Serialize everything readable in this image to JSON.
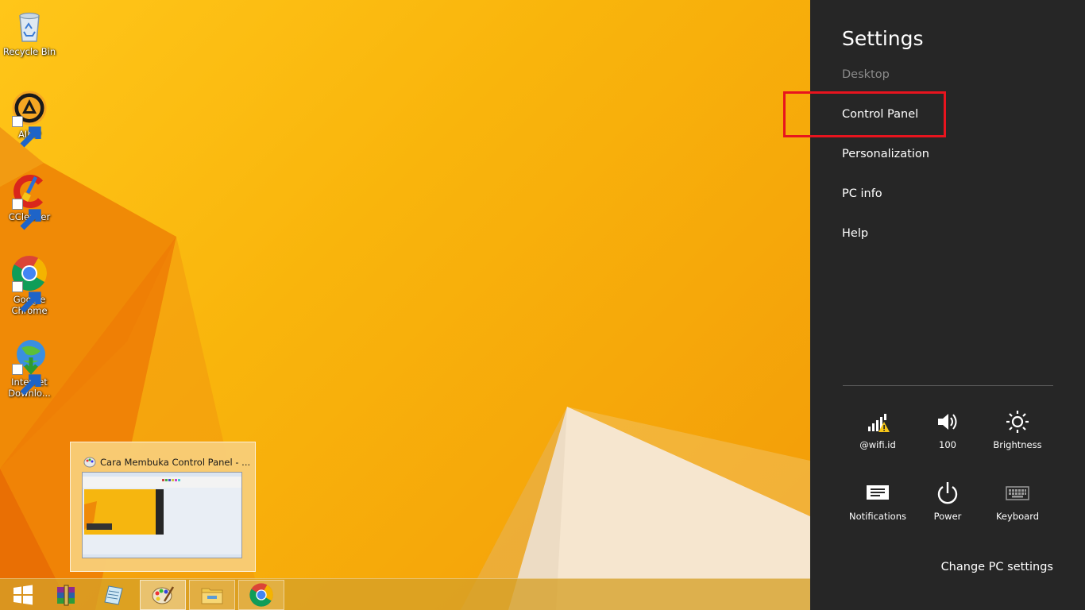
{
  "desktop": {
    "icons": [
      {
        "label": "Recycle Bin",
        "icon": "recycle-bin-icon"
      },
      {
        "label": "AIMP",
        "icon": "aimp-icon"
      },
      {
        "label": "CCleaner",
        "icon": "ccleaner-icon"
      },
      {
        "label": "Google Chrome",
        "icon": "chrome-icon"
      },
      {
        "label": "Internet Downlo...",
        "icon": "idm-icon"
      }
    ]
  },
  "taskbar": {
    "buttons": [
      {
        "name": "start",
        "icon": "windows-start-icon"
      },
      {
        "name": "winrar",
        "icon": "winrar-icon"
      },
      {
        "name": "notepad",
        "icon": "notepad-icon"
      },
      {
        "name": "paint",
        "icon": "paint-icon"
      },
      {
        "name": "file-explorer",
        "icon": "folder-icon"
      },
      {
        "name": "chrome",
        "icon": "chrome-icon"
      }
    ],
    "preview_title": "Cara Membuka Control Panel - ..."
  },
  "settings": {
    "title": "Settings",
    "items": [
      {
        "label": "Desktop"
      },
      {
        "label": "Control Panel"
      },
      {
        "label": "Personalization"
      },
      {
        "label": "PC info"
      },
      {
        "label": "Help"
      }
    ],
    "quick": [
      {
        "label": "@wifi.id",
        "icon": "wifi-warning-icon"
      },
      {
        "label": "100",
        "icon": "volume-icon"
      },
      {
        "label": "Brightness",
        "icon": "brightness-icon"
      },
      {
        "label": "Notifications",
        "icon": "notifications-icon"
      },
      {
        "label": "Power",
        "icon": "power-icon"
      },
      {
        "label": "Keyboard",
        "icon": "keyboard-icon"
      }
    ],
    "change_pc_settings": "Change PC settings"
  },
  "colors": {
    "charm_bg": "#262626",
    "highlight": "#e8141e",
    "wallpaper": "#f9b50c"
  }
}
